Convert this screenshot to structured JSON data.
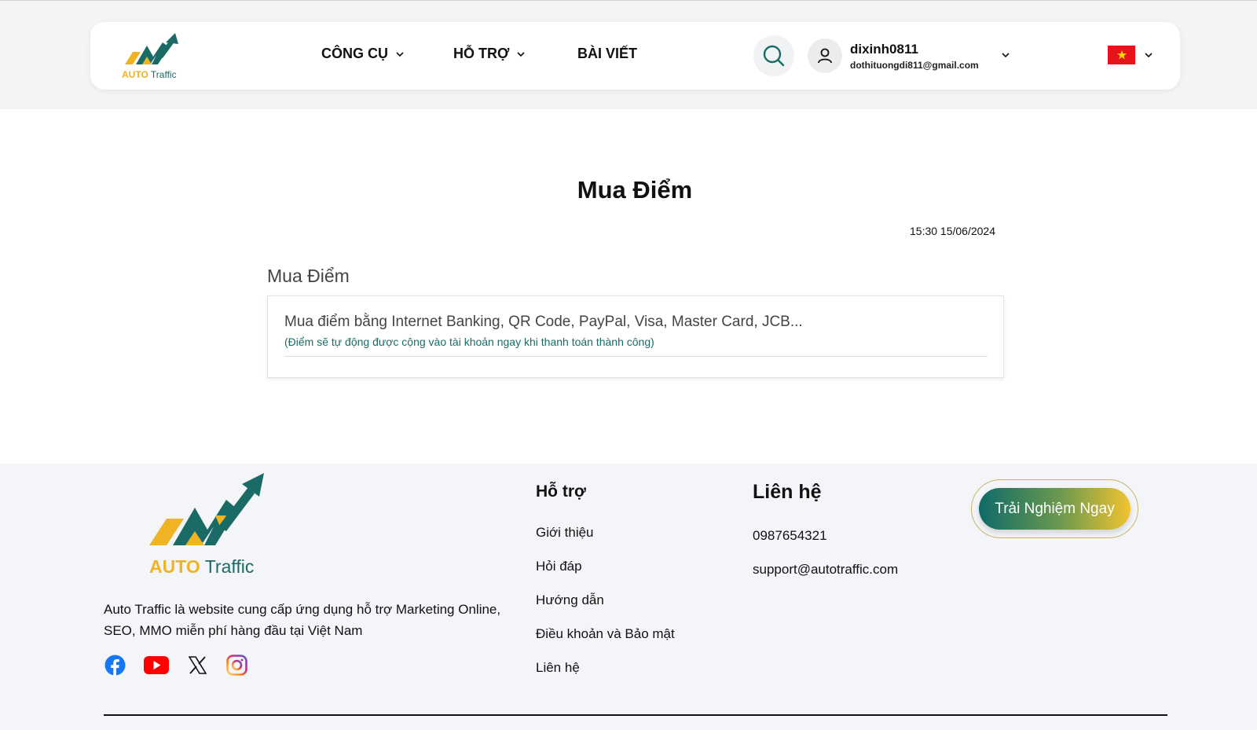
{
  "brand": {
    "auto": "AUTO",
    "traffic": "Traffic"
  },
  "nav": {
    "tools": "CÔNG CỤ",
    "support": "HỖ TRỢ",
    "articles": "BÀI VIẾT"
  },
  "user": {
    "name": "dixinh0811",
    "email": "dothituongdi811@gmail.com"
  },
  "colors": {
    "teal": "#1a6b66",
    "gold": "#f0b323",
    "flag_red": "#e8141c"
  },
  "icons": [
    "search-icon",
    "user-icon",
    "chevron-down-icon",
    "vietnam-flag-icon",
    "facebook-icon",
    "youtube-icon",
    "x-icon",
    "instagram-icon"
  ],
  "main": {
    "title": "Mua Điểm",
    "timestamp": "15:30 15/06/2024",
    "section_label": "Mua Điểm",
    "card_title": "Mua điểm bằng Internet Banking, QR Code, PayPal, Visa, Master Card, JCB...",
    "card_note": "(Điểm sẽ tự động được cộng vào tài khoản ngay khi thanh toán thành công)"
  },
  "footer": {
    "description": "Auto Traffic là website cung cấp ứng dụng hỗ trợ Marketing Online, SEO, MMO miễn phí hàng đầu tại Việt Nam",
    "support_title": "Hỗ trợ",
    "support_links": [
      "Giới thiệu",
      "Hỏi đáp",
      "Hướng dẫn",
      "Điều khoản và Bảo mật",
      "Liên hệ"
    ],
    "contact_title": "Liên hệ",
    "phone": "0987654321",
    "email": "support@autotraffic.com",
    "cta": "Trải Nghiệm Ngay"
  }
}
